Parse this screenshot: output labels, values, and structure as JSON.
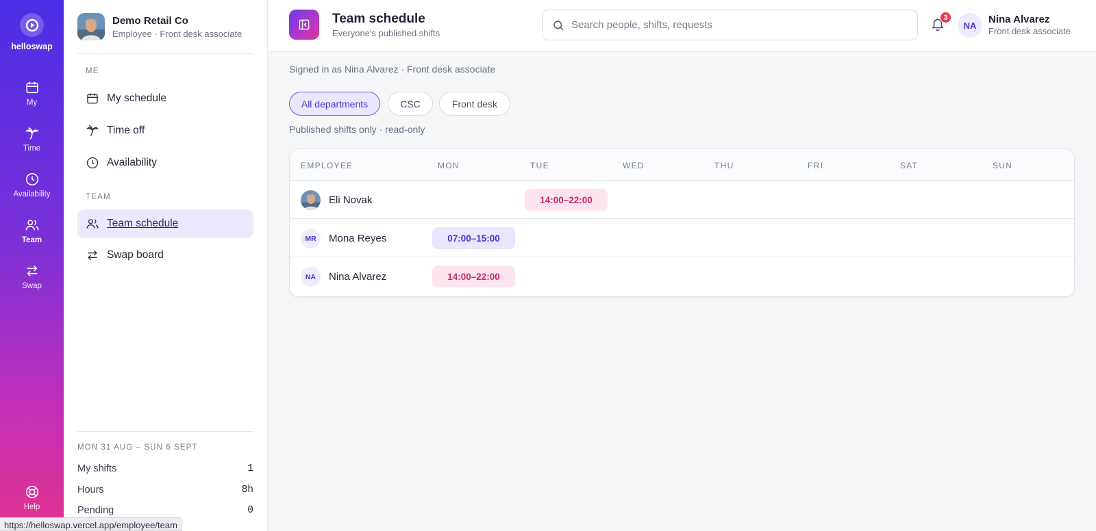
{
  "rail": {
    "brand": "helloswap",
    "items": [
      {
        "label": "My",
        "icon": "calendar-icon"
      },
      {
        "label": "Time",
        "icon": "palm-tree-icon"
      },
      {
        "label": "Availability",
        "icon": "clock-icon"
      },
      {
        "label": "Team",
        "icon": "users-icon"
      },
      {
        "label": "Swap",
        "icon": "swap-arrows-icon"
      }
    ],
    "help": "Help"
  },
  "sidebar": {
    "org_name": "Demo Retail Co",
    "org_role": "Employee · Front desk associate",
    "section_me": "ME",
    "section_team": "TEAM",
    "nav": [
      {
        "label": "My schedule",
        "icon": "calendar-icon"
      },
      {
        "label": "Time off",
        "icon": "palm-tree-icon"
      },
      {
        "label": "Availability",
        "icon": "clock-icon"
      },
      {
        "label": "Team schedule",
        "icon": "users-icon",
        "active": true
      },
      {
        "label": "Swap board",
        "icon": "swap-arrows-icon"
      }
    ],
    "week": "MON 31 AUG – SUN 6 SEPT",
    "stats": [
      {
        "label": "My shifts",
        "value": "1"
      },
      {
        "label": "Hours",
        "value": "8h"
      },
      {
        "label": "Pending",
        "value": "0"
      }
    ],
    "status_url": "https://helloswap.vercel.app/employee/team"
  },
  "header": {
    "title": "Team schedule",
    "subtitle": "Everyone's published shifts",
    "search_placeholder": "Search people, shifts, requests",
    "notifications": "3",
    "user_initials": "NA",
    "user_name": "Nina Alvarez",
    "user_role": "Front desk associate"
  },
  "main": {
    "signed_in": "Signed in as Nina Alvarez · Front desk associate",
    "filters": [
      "All departments",
      "CSC",
      "Front desk"
    ],
    "active_filter": "All departments",
    "note": "Published shifts only · read-only",
    "columns": [
      "EMPLOYEE",
      "MON",
      "TUE",
      "WED",
      "THU",
      "FRI",
      "SAT",
      "SUN"
    ],
    "rows": [
      {
        "name": "Eli Novak",
        "initials": "",
        "photo": true,
        "shifts": {
          "TUE": "14:00–22:00"
        }
      },
      {
        "name": "Mona Reyes",
        "initials": "MR",
        "photo": false,
        "shifts": {
          "MON": "07:00–15:00"
        }
      },
      {
        "name": "Nina Alvarez",
        "initials": "NA",
        "photo": false,
        "shifts": {
          "MON": "14:00–22:00"
        }
      }
    ]
  },
  "colors": {
    "accent": "#4a35d6",
    "shift_pink_bg": "#fde4ee",
    "shift_pink_text": "#c4286b",
    "shift_lavender_bg": "#e9e6fd",
    "badge": "#e5384f"
  }
}
